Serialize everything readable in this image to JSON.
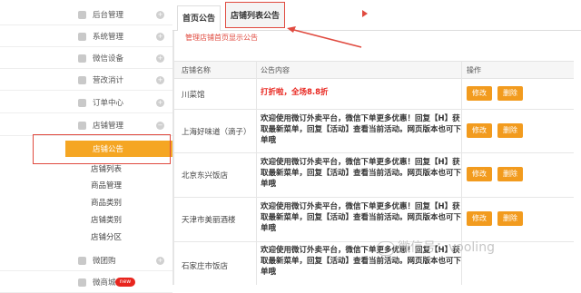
{
  "sidebar": {
    "items": [
      {
        "label": "后台管理",
        "toggle": "+"
      },
      {
        "label": "系统管理",
        "toggle": "+"
      },
      {
        "label": "微信设备",
        "toggle": "+"
      },
      {
        "label": "营改消计",
        "toggle": "+"
      },
      {
        "label": "订单中心",
        "toggle": "+"
      },
      {
        "label": "店铺管理",
        "toggle": "−"
      }
    ],
    "sub_items": [
      "店铺公告",
      "店铺列表",
      "商品管理",
      "商品类别",
      "店铺类别",
      "店铺分区"
    ],
    "active_sub": "店铺公告",
    "bottom_items": [
      {
        "label": "微团购",
        "toggle": "+"
      },
      {
        "label": "微商城",
        "badge": "new"
      }
    ]
  },
  "tabs": [
    {
      "label": "首页公告"
    },
    {
      "label": "店铺列表公告"
    }
  ],
  "notice_link": "管理店铺首页显示公告",
  "table": {
    "headers": [
      "店铺名称",
      "公告内容",
      "操作"
    ],
    "edit_label": "修改",
    "delete_label": "删除",
    "rows": [
      {
        "shop": "川菜馆",
        "content": "打折啦，全场8.8折",
        "highlight": true
      },
      {
        "shop": "上海好味道（滴子）",
        "content": "欢迎使用微订外卖平台，微信下单更多优惠！回复【H】获取最新菜单，回复【活动】查看当前活动。网页版本也可下单哦"
      },
      {
        "shop": "北京东兴饭店",
        "content": "欢迎使用微订外卖平台，微信下单更多优惠！回复【H】获取最新菜单，回复【活动】查看当前活动。网页版本也可下单哦"
      },
      {
        "shop": "天津市美丽酒楼",
        "content": "欢迎使用微订外卖平台，微信下单更多优惠！回复【H】获取最新菜单，回复【活动】查看当前活动。网页版本也可下单哦"
      },
      {
        "shop": "石家庄市饭店",
        "content": "欢迎使用微订外卖平台，微信下单更多优惠！回复【H】获取最新菜单，回复【活动】查看当前活动。网页版本也可下单哦"
      }
    ]
  },
  "watermark": "微信号：vooling",
  "colors": {
    "accent": "#f29b1e",
    "annotation_red": "#e04a3f",
    "new_badge": "#e8251e"
  }
}
